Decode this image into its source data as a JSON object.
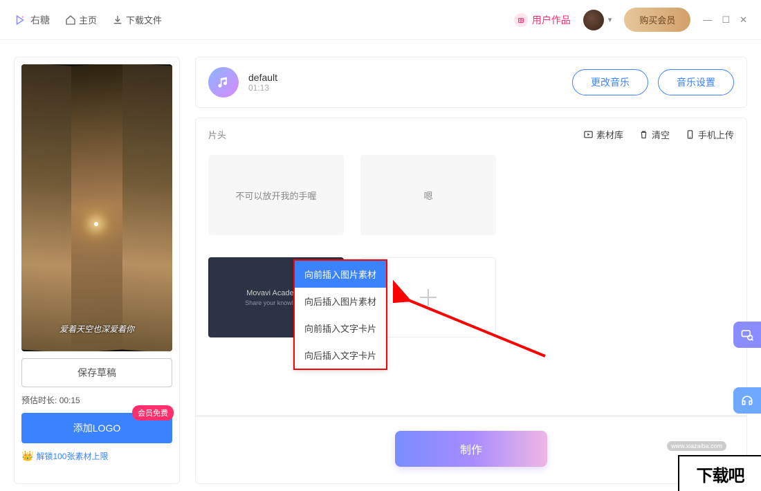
{
  "titlebar": {
    "logo": "右糖",
    "home": "主页",
    "download": "下载文件",
    "user_works": "用户作品",
    "buy": "购买会员"
  },
  "preview": {
    "caption": "爱着天空也深爱着你",
    "save_draft": "保存草稿",
    "eta_label": "预估时长:",
    "eta_value": "00:15",
    "add_logo": "添加LOGO",
    "badge": "会员免费",
    "unlock": "解锁100张素材上限"
  },
  "music": {
    "name": "default",
    "time": "01:13",
    "change": "更改音乐",
    "settings": "音乐设置"
  },
  "clips": {
    "section_label": "片头",
    "tools": {
      "library": "素材库",
      "clear": "清空",
      "mobile": "手机上传"
    },
    "row1": [
      "不可以放开我的手喔",
      "嗯"
    ],
    "row2": {
      "dark_title": "Movavi Academic",
      "dark_sub": "Share your knowledge"
    },
    "ctx": [
      "向前插入图片素材",
      "向后插入图片素材",
      "向前插入文字卡片",
      "向后插入文字卡片"
    ]
  },
  "make": "制作",
  "watermark": {
    "url": "www.xiazaiba.com",
    "logo": "下载吧"
  }
}
